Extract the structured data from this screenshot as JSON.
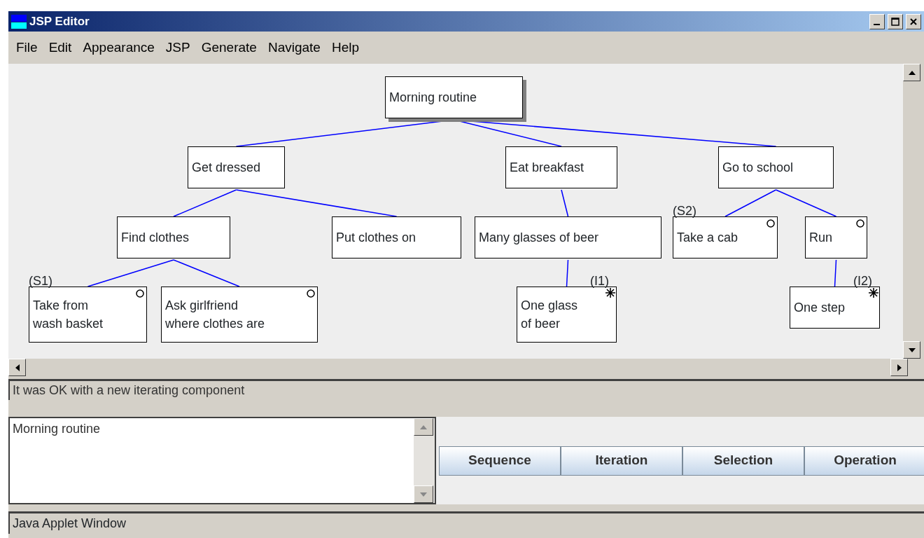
{
  "window": {
    "title": "JSP Editor"
  },
  "menu": [
    "File",
    "Edit",
    "Appearance",
    "JSP",
    "Generate",
    "Navigate",
    "Help"
  ],
  "diagram": {
    "root": {
      "lines": [
        "Morning routine"
      ],
      "selected": true,
      "children": [
        {
          "lines": [
            "Get dressed"
          ],
          "selected": false,
          "children": [
            {
              "lines": [
                "Find clothes"
              ],
              "selected": false,
              "children": [
                {
                  "lines": [
                    "Take from",
                    "wash basket"
                  ],
                  "kind": "selection",
                  "tag": "(S1)",
                  "selected": false
                },
                {
                  "lines": [
                    "Ask girlfriend",
                    "where clothes are"
                  ],
                  "kind": "selection",
                  "selected": false
                }
              ]
            },
            {
              "lines": [
                "Put clothes on"
              ],
              "selected": false
            }
          ]
        },
        {
          "lines": [
            "Eat breakfast"
          ],
          "selected": false,
          "children": [
            {
              "lines": [
                "Many glasses of beer"
              ],
              "selected": false,
              "children": [
                {
                  "lines": [
                    "One glass",
                    "of beer"
                  ],
                  "kind": "iteration",
                  "tag": "(I1)",
                  "selected": false
                }
              ]
            }
          ]
        },
        {
          "lines": [
            "Go to school"
          ],
          "selected": false,
          "children": [
            {
              "lines": [
                "Take a cab"
              ],
              "kind": "selection",
              "tag": "(S2)",
              "selected": false
            },
            {
              "lines": [
                "Run"
              ],
              "kind": "selection",
              "selected": false,
              "children": [
                {
                  "lines": [
                    "One step"
                  ],
                  "kind": "iteration",
                  "tag": "(I2)",
                  "selected": false
                }
              ]
            }
          ]
        }
      ]
    }
  },
  "message": "It was OK with a new iterating component",
  "text_area": {
    "value": "Morning routine"
  },
  "buttons": [
    "Sequence",
    "Iteration",
    "Selection",
    "Operation"
  ],
  "status_bar": "Java Applet Window"
}
